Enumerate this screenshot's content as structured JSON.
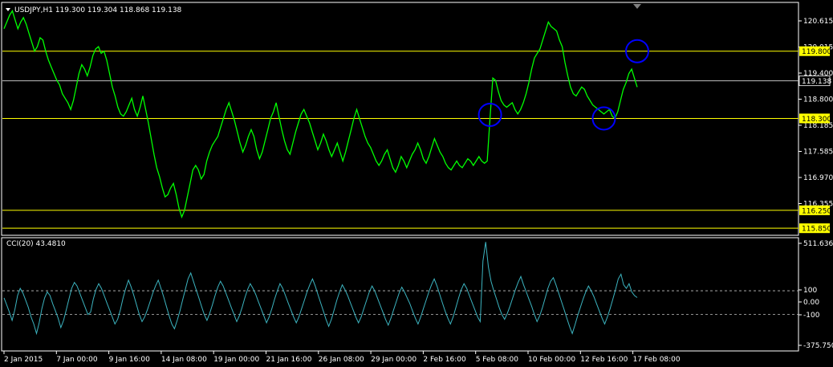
{
  "header": {
    "main": "USDJPY,H1  119.300 119.304 118.868 119.138",
    "indicator": "CCI(20) 43.4810"
  },
  "colors": {
    "background": "#000000",
    "frame": "#ffffff",
    "price_line": "#00ff00",
    "cci_line": "#3cb4c0",
    "level_line": "#ffff00",
    "current_line": "#c0c0c0",
    "level_label_bg": "#ffff00",
    "circle": "#0000ff"
  },
  "chart_data": [
    {
      "type": "line",
      "series": [
        {
          "y": [
            120.3,
            120.45,
            120.6,
            120.7,
            120.5,
            120.3,
            120.45,
            120.55,
            120.4,
            120.2,
            120.0,
            119.8,
            119.9,
            120.1,
            120.05,
            119.8,
            119.6,
            119.45,
            119.3,
            119.15,
            119.05,
            118.85,
            118.75,
            118.65,
            118.5,
            118.7,
            119.0,
            119.3,
            119.5,
            119.4,
            119.25,
            119.45,
            119.7,
            119.85,
            119.9,
            119.75,
            119.8,
            119.6,
            119.3,
            119.0,
            118.8,
            118.55,
            118.4,
            118.35,
            118.45,
            118.6,
            118.75,
            118.5,
            118.35,
            118.55,
            118.8,
            118.5,
            118.2,
            117.85,
            117.5,
            117.2,
            117.0,
            116.75,
            116.55,
            116.6,
            116.75,
            116.85,
            116.6,
            116.3,
            116.1,
            116.25,
            116.55,
            116.85,
            117.15,
            117.25,
            117.15,
            116.95,
            117.05,
            117.35,
            117.55,
            117.7,
            117.8,
            117.9,
            118.1,
            118.3,
            118.5,
            118.65,
            118.45,
            118.25,
            118.0,
            117.75,
            117.55,
            117.7,
            117.9,
            118.05,
            117.9,
            117.6,
            117.4,
            117.55,
            117.8,
            118.05,
            118.3,
            118.45,
            118.65,
            118.35,
            118.05,
            117.8,
            117.6,
            117.5,
            117.75,
            118.0,
            118.2,
            118.4,
            118.5,
            118.35,
            118.2,
            118.0,
            117.8,
            117.6,
            117.75,
            117.95,
            117.8,
            117.6,
            117.45,
            117.6,
            117.75,
            117.55,
            117.35,
            117.55,
            117.8,
            118.05,
            118.3,
            118.5,
            118.3,
            118.1,
            117.9,
            117.75,
            117.65,
            117.5,
            117.35,
            117.25,
            117.35,
            117.5,
            117.6,
            117.4,
            117.2,
            117.1,
            117.25,
            117.45,
            117.35,
            117.2,
            117.35,
            117.5,
            117.6,
            117.75,
            117.6,
            117.4,
            117.3,
            117.45,
            117.65,
            117.85,
            117.7,
            117.55,
            117.45,
            117.3,
            117.2,
            117.15,
            117.25,
            117.35,
            117.25,
            117.2,
            117.3,
            117.4,
            117.35,
            117.25,
            117.35,
            117.45,
            117.35,
            117.3,
            117.35,
            118.3,
            119.2,
            119.15,
            118.9,
            118.7,
            118.6,
            118.55,
            118.6,
            118.65,
            118.5,
            118.4,
            118.5,
            118.65,
            118.85,
            119.1,
            119.4,
            119.65,
            119.75,
            119.85,
            120.05,
            120.25,
            120.45,
            120.35,
            120.3,
            120.25,
            120.05,
            119.9,
            119.55,
            119.25,
            119.0,
            118.85,
            118.8,
            118.9,
            119.0,
            118.95,
            118.8,
            118.7,
            118.6,
            118.55,
            118.5,
            118.45,
            118.4,
            118.45,
            118.5,
            118.35,
            118.3,
            118.45,
            118.7,
            118.95,
            119.1,
            119.3,
            119.4,
            119.2,
            119.0
          ]
        }
      ],
      "ylim": [
        115.71,
        120.87
      ],
      "y_ticks": [
        "120.615",
        "120.015",
        "119.400",
        "118.800",
        "118.185",
        "117.585",
        "116.970",
        "116.355"
      ],
      "levels": [
        {
          "label": "119.800",
          "value": 119.8,
          "kind": "level"
        },
        {
          "label": "118.300",
          "value": 118.3,
          "kind": "level"
        },
        {
          "label": "116.250",
          "value": 116.25,
          "kind": "level"
        },
        {
          "label": "115.850",
          "value": 115.85,
          "kind": "level"
        },
        {
          "label": "119.138",
          "value": 119.138,
          "kind": "current"
        }
      ],
      "x_ticks": [
        "2 Jan 2015",
        "7 Jan 00:00",
        "9 Jan 16:00",
        "14 Jan 08:00",
        "19 Jan 00:00",
        "21 Jan 16:00",
        "26 Jan 08:00",
        "29 Jan 00:00",
        "2 Feb 16:00",
        "5 Feb 08:00",
        "10 Feb 00:00",
        "12 Feb 16:00",
        "17 Feb 08:00"
      ],
      "circles": [
        {
          "index": 175,
          "value": 118.38
        },
        {
          "index": 216,
          "value": 118.3
        },
        {
          "index": 228,
          "value": 119.8
        }
      ]
    },
    {
      "type": "line",
      "series": [
        {
          "y": [
            40,
            -20,
            -80,
            -150,
            -60,
            60,
            120,
            80,
            20,
            -40,
            -120,
            -180,
            -260,
            -170,
            -50,
            40,
            90,
            60,
            -10,
            -70,
            -130,
            -210,
            -150,
            -60,
            30,
            120,
            170,
            140,
            80,
            20,
            -40,
            -100,
            -80,
            30,
            110,
            160,
            120,
            60,
            0,
            -60,
            -120,
            -180,
            -140,
            -60,
            40,
            120,
            190,
            130,
            60,
            -20,
            -100,
            -160,
            -120,
            -60,
            10,
            80,
            140,
            190,
            120,
            50,
            -30,
            -110,
            -180,
            -220,
            -150,
            -70,
            20,
            110,
            200,
            250,
            180,
            110,
            40,
            -30,
            -100,
            -150,
            -90,
            -20,
            60,
            130,
            180,
            140,
            80,
            20,
            -40,
            -100,
            -160,
            -110,
            -40,
            40,
            110,
            160,
            120,
            70,
            10,
            -50,
            -110,
            -170,
            -120,
            -50,
            30,
            100,
            160,
            120,
            60,
            0,
            -60,
            -120,
            -170,
            -120,
            -50,
            20,
            90,
            150,
            200,
            140,
            70,
            0,
            -70,
            -140,
            -200,
            -140,
            -60,
            20,
            90,
            150,
            110,
            60,
            0,
            -60,
            -120,
            -170,
            -120,
            -50,
            20,
            90,
            140,
            100,
            40,
            -20,
            -80,
            -140,
            -190,
            -130,
            -60,
            10,
            80,
            130,
            90,
            40,
            -10,
            -70,
            -130,
            -180,
            -120,
            -50,
            20,
            90,
            150,
            200,
            140,
            70,
            0,
            -70,
            -130,
            -180,
            -120,
            -40,
            40,
            110,
            160,
            120,
            60,
            0,
            -60,
            -120,
            -160,
            350,
            511,
            300,
            180,
            100,
            30,
            -40,
            -100,
            -140,
            -90,
            -30,
            40,
            110,
            170,
            220,
            150,
            90,
            30,
            -30,
            -100,
            -160,
            -110,
            -40,
            40,
            120,
            180,
            210,
            150,
            80,
            10,
            -60,
            -130,
            -200,
            -260,
            -190,
            -110,
            -40,
            30,
            90,
            140,
            100,
            50,
            -10,
            -70,
            -130,
            -180,
            -120,
            -50,
            30,
            110,
            200,
            240,
            150,
            120,
            160,
            90,
            60,
            43
          ]
        }
      ],
      "ylim": [
        -400,
        540
      ],
      "y_ticks": [
        "511.636",
        "100",
        "0.00",
        "-100",
        "-375.7502"
      ]
    }
  ]
}
